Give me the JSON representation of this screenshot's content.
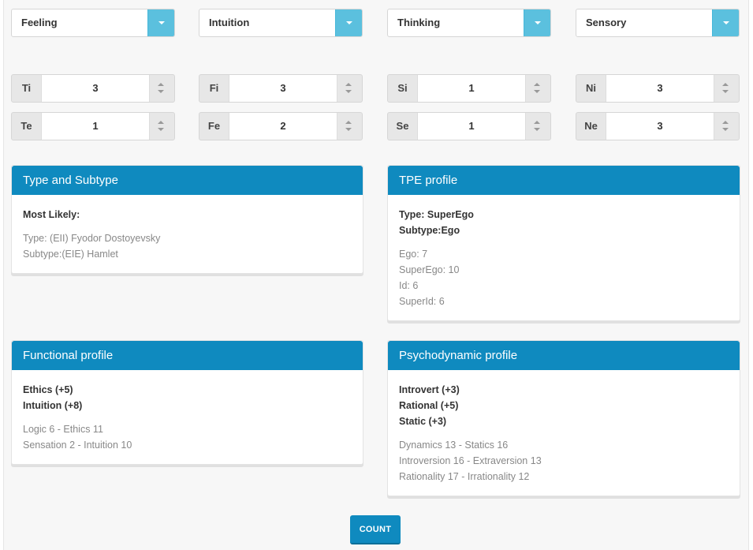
{
  "selects": [
    {
      "value": "Feeling"
    },
    {
      "value": "Intuition"
    },
    {
      "value": "Thinking"
    },
    {
      "value": "Sensory"
    }
  ],
  "steppers": {
    "row1": [
      {
        "label": "Ti",
        "value": "3"
      },
      {
        "label": "Fi",
        "value": "3"
      },
      {
        "label": "Si",
        "value": "1"
      },
      {
        "label": "Ni",
        "value": "3"
      }
    ],
    "row2": [
      {
        "label": "Te",
        "value": "1"
      },
      {
        "label": "Fe",
        "value": "2"
      },
      {
        "label": "Se",
        "value": "1"
      },
      {
        "label": "Ne",
        "value": "3"
      }
    ]
  },
  "panels": {
    "type_subtype": {
      "title": "Type and Subtype",
      "heading": "Most Likely:",
      "lines": [
        "Type: (EII) Fyodor Dostoyevsky",
        "Subtype:(EIE) Hamlet"
      ]
    },
    "tpe": {
      "title": "TPE profile",
      "bold": [
        "Type: SuperEgo",
        "Subtype:Ego"
      ],
      "lines": [
        "Ego: 7",
        "SuperEgo: 10",
        "Id: 6",
        "SuperId: 6"
      ]
    },
    "functional": {
      "title": "Functional profile",
      "bold": [
        "Ethics (+5)",
        "Intuition (+8)"
      ],
      "lines": [
        "Logic 6 - Ethics 11",
        "Sensation 2 - Intuition 10"
      ]
    },
    "psychodynamic": {
      "title": "Psychodynamic profile",
      "bold": [
        "Introvert (+3)",
        "Rational (+5)",
        "Static (+3)"
      ],
      "lines": [
        "Dynamics 13 - Statics 16",
        "Introversion 16 - Extraversion 13",
        "Rationality 17 - Irrationality 12"
      ]
    }
  },
  "count_label": "COUNT",
  "colors": {
    "accent": "#0f8abf",
    "select_button": "#5bc0de"
  }
}
